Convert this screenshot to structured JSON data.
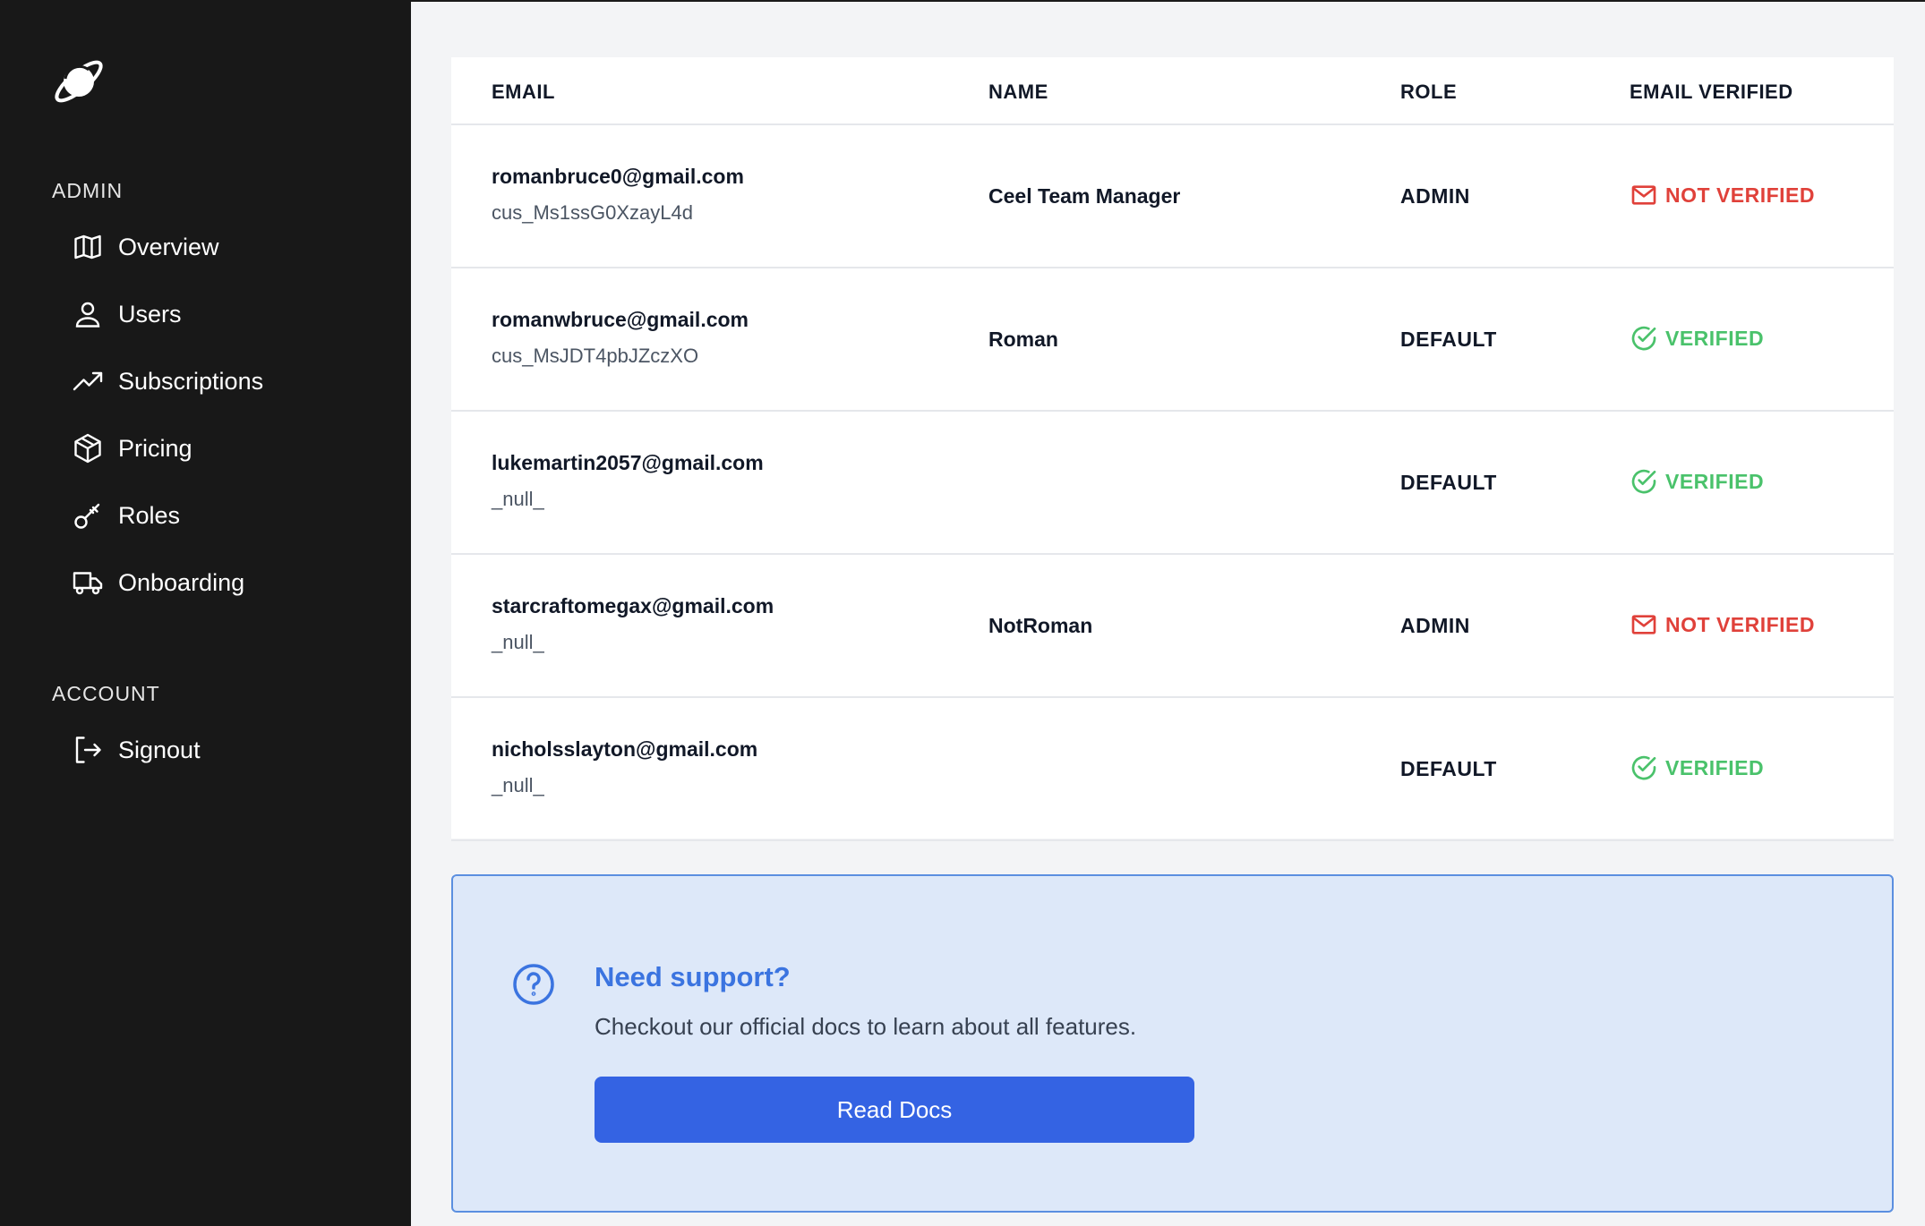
{
  "sidebar": {
    "logo_icon": "planet-icon",
    "admin_label": "ADMIN",
    "account_label": "ACCOUNT",
    "items": [
      {
        "label": "Overview",
        "icon": "map-icon"
      },
      {
        "label": "Users",
        "icon": "user-icon"
      },
      {
        "label": "Subscriptions",
        "icon": "trending-up-icon"
      },
      {
        "label": "Pricing",
        "icon": "cube-icon"
      },
      {
        "label": "Roles",
        "icon": "key-icon"
      },
      {
        "label": "Onboarding",
        "icon": "truck-icon"
      }
    ],
    "signout": {
      "label": "Signout",
      "icon": "logout-icon"
    }
  },
  "table": {
    "headers": {
      "email": "EMAIL",
      "name": "NAME",
      "role": "ROLE",
      "verified": "EMAIL VERIFIED"
    },
    "rows": [
      {
        "email": "romanbruce0@gmail.com",
        "customer_id": "cus_Ms1ssG0XzayL4d",
        "name": "Ceel Team Manager",
        "role": "ADMIN",
        "status": "NOT VERIFIED"
      },
      {
        "email": "romanwbruce@gmail.com",
        "customer_id": "cus_MsJDT4pbJZczXO",
        "name": "Roman",
        "role": "DEFAULT",
        "status": "VERIFIED"
      },
      {
        "email": "lukemartin2057@gmail.com",
        "customer_id": "_null_",
        "name": "",
        "role": "DEFAULT",
        "status": "VERIFIED"
      },
      {
        "email": "starcraftomegax@gmail.com",
        "customer_id": "_null_",
        "name": "NotRoman",
        "role": "ADMIN",
        "status": "NOT VERIFIED"
      },
      {
        "email": "nicholsslayton@gmail.com",
        "customer_id": "_null_",
        "name": "",
        "role": "DEFAULT",
        "status": "VERIFIED"
      }
    ]
  },
  "support": {
    "icon": "question-circle-icon",
    "title": "Need support?",
    "text": "Checkout our official docs to learn about all features.",
    "button_label": "Read Docs"
  },
  "colors": {
    "sidebar_bg": "#181818",
    "verified": "#4ac26b",
    "not_verified": "#e0413a",
    "accent": "#3463e3",
    "support_bg": "#dde8f9"
  }
}
